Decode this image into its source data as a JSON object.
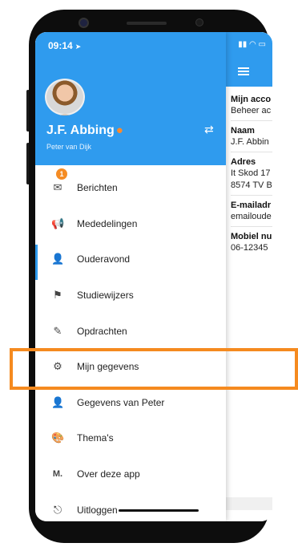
{
  "status_bar": {
    "time": "09:14",
    "location_icon": "location-arrow-icon",
    "icons": "signal wifi battery"
  },
  "drawer_header": {
    "name": "J.F. Abbing",
    "subtitle": "Peter van Dijk",
    "switch_icon": "swap-arrows-icon"
  },
  "menu": {
    "items": [
      {
        "label": "Berichten",
        "icon": "envelope-icon",
        "badge": "1"
      },
      {
        "label": "Mededelingen",
        "icon": "megaphone-icon"
      },
      {
        "label": "Ouderavond",
        "icon": "person-clock-icon"
      },
      {
        "label": "Studiewijzers",
        "icon": "signpost-icon"
      },
      {
        "label": "Opdrachten",
        "icon": "pencil-icon"
      },
      {
        "label": "Mijn gegevens",
        "icon": "gear-icon"
      },
      {
        "label": "Gegevens van Peter",
        "icon": "person-icon"
      },
      {
        "label": "Thema's",
        "icon": "palette-icon"
      },
      {
        "label": "Over deze app",
        "icon": "m-logo-icon",
        "glyph": "M."
      },
      {
        "label": "Uitloggen",
        "icon": "logout-icon"
      }
    ]
  },
  "panel": {
    "rows": [
      {
        "label": "Mijn acco",
        "value": "Beheer ac"
      },
      {
        "label": "Naam",
        "value": "J.F. Abbin"
      },
      {
        "label": "Adres",
        "value": "It Skod 17"
      },
      {
        "label": "",
        "value": "8574 TV B"
      },
      {
        "label": "E-mailadr",
        "value": "emailoude"
      },
      {
        "label": "Mobiel nu",
        "value": "06-12345"
      }
    ]
  },
  "colors": {
    "accent": "#2f9bee",
    "highlight": "#f58a1f",
    "badge": "#f58c24"
  }
}
